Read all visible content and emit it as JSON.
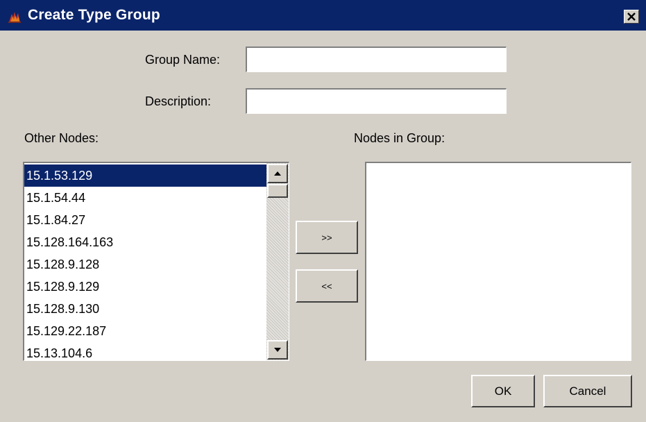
{
  "window": {
    "title": "Create Type Group",
    "icon": "app-icon",
    "close_icon": "close-icon"
  },
  "form": {
    "group_name_label": "Group Name:",
    "group_name_value": "",
    "description_label": "Description:",
    "description_value": ""
  },
  "other_nodes": {
    "label": "Other Nodes:",
    "items": [
      "15.1.53.129",
      "15.1.54.44",
      "15.1.84.27",
      "15.128.164.163",
      "15.128.9.128",
      "15.128.9.129",
      "15.128.9.130",
      "15.129.22.187",
      "15.13.104.6"
    ],
    "selected_index": 0
  },
  "nodes_in_group": {
    "label": "Nodes in Group:",
    "items": []
  },
  "buttons": {
    "add": ">>",
    "remove": "<<",
    "ok": "OK",
    "cancel": "Cancel"
  },
  "colors": {
    "titlebar": "#0a246a",
    "selection": "#0a246a",
    "face": "#d4d0c8"
  }
}
